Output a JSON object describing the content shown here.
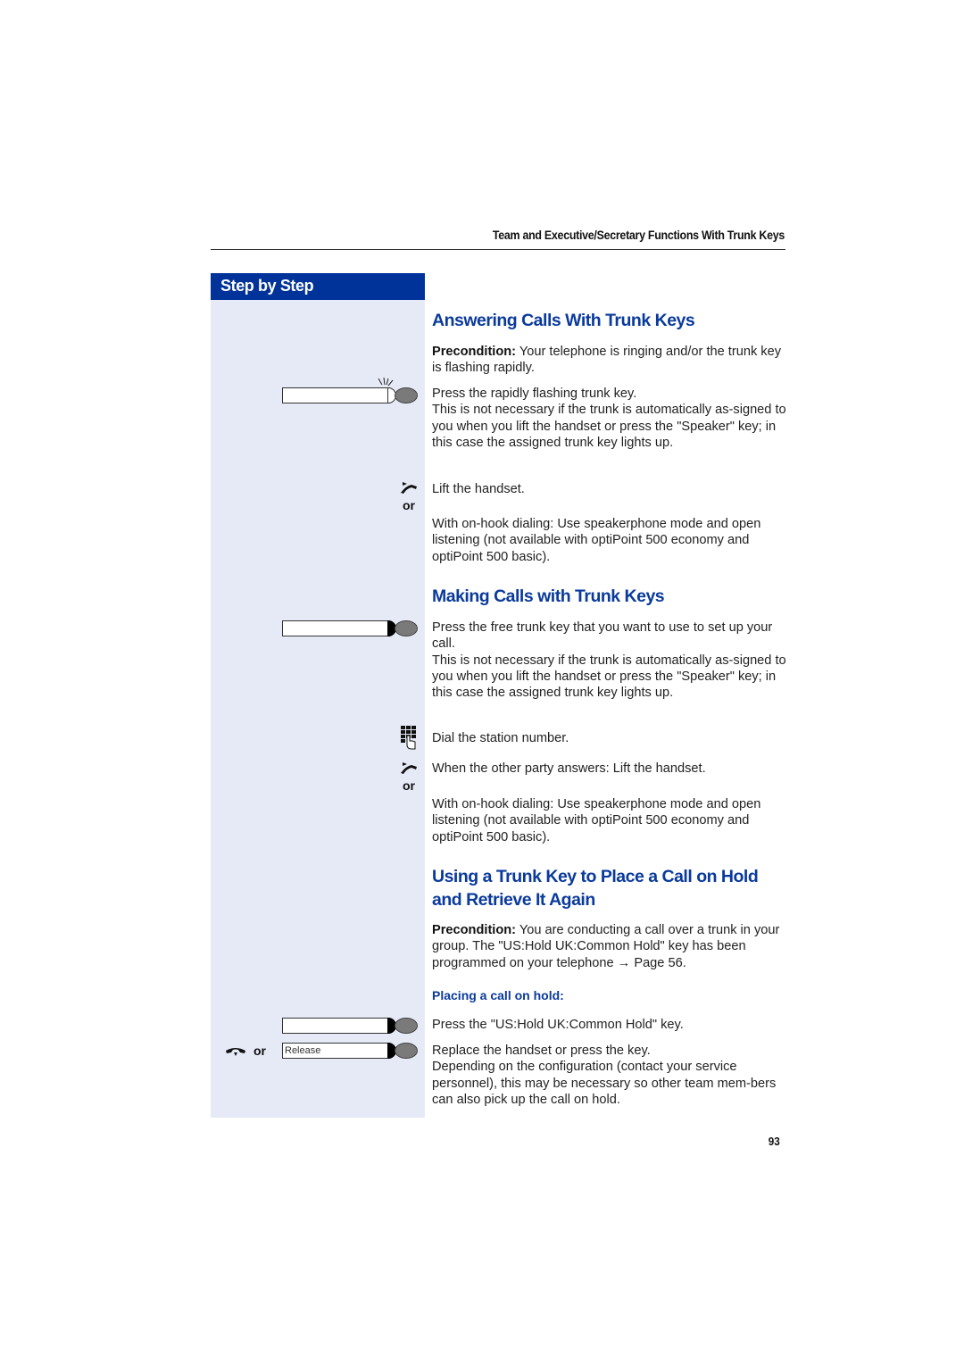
{
  "header": {
    "running_title": "Team and Executive/Secretary Functions With Trunk Keys"
  },
  "sidebar": {
    "title": "Step by Step"
  },
  "colors": {
    "brand_blue": "#003399",
    "sidebar_bg": "#e6eaf6",
    "heading_blue": "#0a3a9c"
  },
  "sections": {
    "answering": {
      "title": "Answering Calls With Trunk Keys",
      "precondition_label": "Precondition:",
      "precondition_text": " Your telephone is ringing and/or the trunk key is flashing rapidly.",
      "step1": "Press the rapidly flashing trunk key.",
      "step1_note": "This is not necessary if the trunk is automatically as-signed to you when you lift the handset or press the \"Speaker\" key; in this case the assigned trunk key lights up.",
      "step2": "Lift the handset.",
      "or_label": "or",
      "step3": "With on-hook dialing: Use speakerphone mode and open listening (not available with optiPoint 500 economy and optiPoint 500 basic)."
    },
    "making": {
      "title": "Making Calls with Trunk Keys",
      "step1": "Press the free trunk key that you want to use to set up your call.",
      "step1_note": "This is not necessary if the trunk is automatically as-signed to you when you lift the handset or press the \"Speaker\" key; in this case the assigned trunk key lights up.",
      "step2": "Dial the station number.",
      "step3": "When the other party answers: Lift the handset.",
      "or_label": "or",
      "step4": "With on-hook dialing: Use speakerphone mode and open listening (not available with optiPoint 500 economy and optiPoint 500 basic)."
    },
    "hold": {
      "title": "Using a Trunk Key to Place a Call on Hold and Retrieve It Again",
      "precondition_label": "Precondition:",
      "precondition_text": " You are conducting a call over a trunk in your group. The \"US:Hold UK:Common Hold\" key has been programmed on your telephone → Page 56.",
      "subheading": "Placing a call on hold:",
      "step1": "Press the \"US:Hold UK:Common Hold\" key.",
      "step2": "Replace the handset or press the key.",
      "step2_note": "Depending on the configuration (contact your service personnel), this may be necessary so other team mem-bers can also pick up the call on hold.",
      "or_label": "or",
      "release_key_label": "Release"
    }
  },
  "icons": {
    "flashing_key": "flashing-trunk-key-icon",
    "trunk_key": "trunk-key-icon",
    "lift_handset": "lift-handset-icon",
    "keypad": "keypad-icon",
    "replace_handset": "replace-handset-icon"
  },
  "footer": {
    "page_number": "93"
  }
}
